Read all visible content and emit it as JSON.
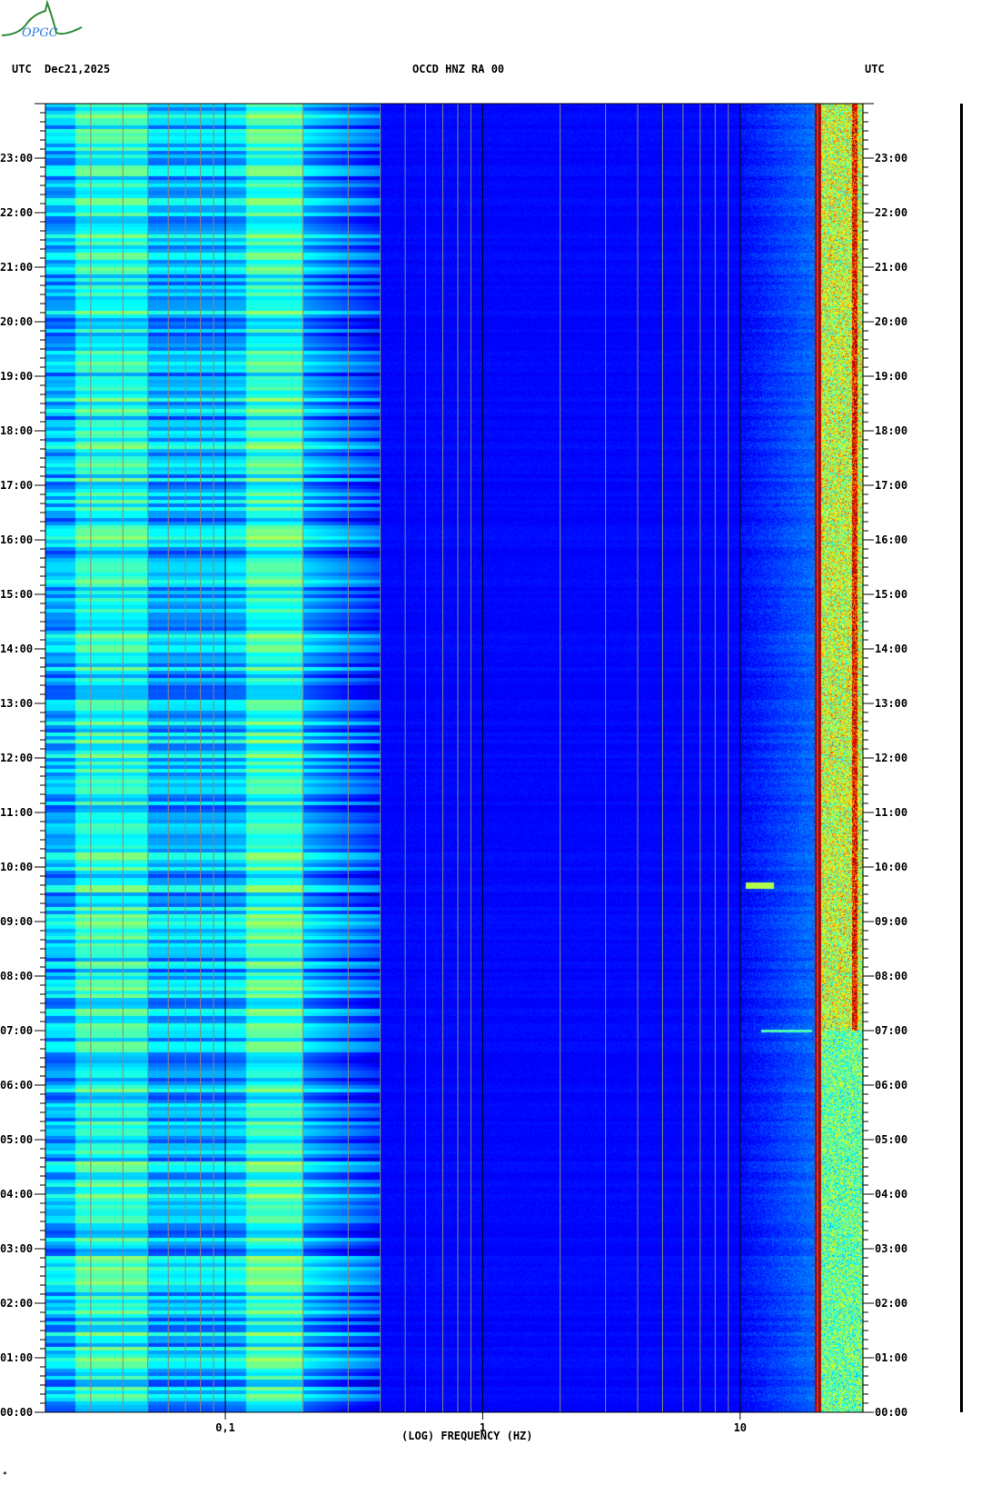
{
  "header": {
    "left_tz": "UTC",
    "date": "Dec21,2025",
    "station": "OCCD HNZ RA 00",
    "right_tz": "UTC"
  },
  "logo": {
    "text": "OPGC"
  },
  "footer_mark": "*",
  "chart_data": {
    "type": "heatmap",
    "title": "OCCD HNZ RA 00",
    "xlabel": "(LOG) FREQUENCY (HZ)",
    "ylabel": "UTC",
    "xscale": "log",
    "xlim": [
      0.02,
      30
    ],
    "ylim_hours": [
      0,
      24
    ],
    "x_ticks": [
      {
        "value": 0.1,
        "label": "0,1"
      },
      {
        "value": 1,
        "label": "1"
      },
      {
        "value": 10,
        "label": "10"
      }
    ],
    "y_ticks": [
      "00:00",
      "01:00",
      "02:00",
      "03:00",
      "04:00",
      "05:00",
      "06:00",
      "07:00",
      "08:00",
      "09:00",
      "10:00",
      "11:00",
      "12:00",
      "13:00",
      "14:00",
      "15:00",
      "16:00",
      "17:00",
      "18:00",
      "19:00",
      "20:00",
      "21:00",
      "22:00",
      "23:00"
    ],
    "minor_tick_minutes": 10,
    "colormap": "jet",
    "features": {
      "microseism_band_hz": [
        0.12,
        0.2
      ],
      "persistent_line_hz": 20,
      "high_energy_band_hz": [
        20,
        30
      ],
      "event_time_utc": "09:40",
      "event_band_hz": [
        10,
        14
      ]
    }
  }
}
